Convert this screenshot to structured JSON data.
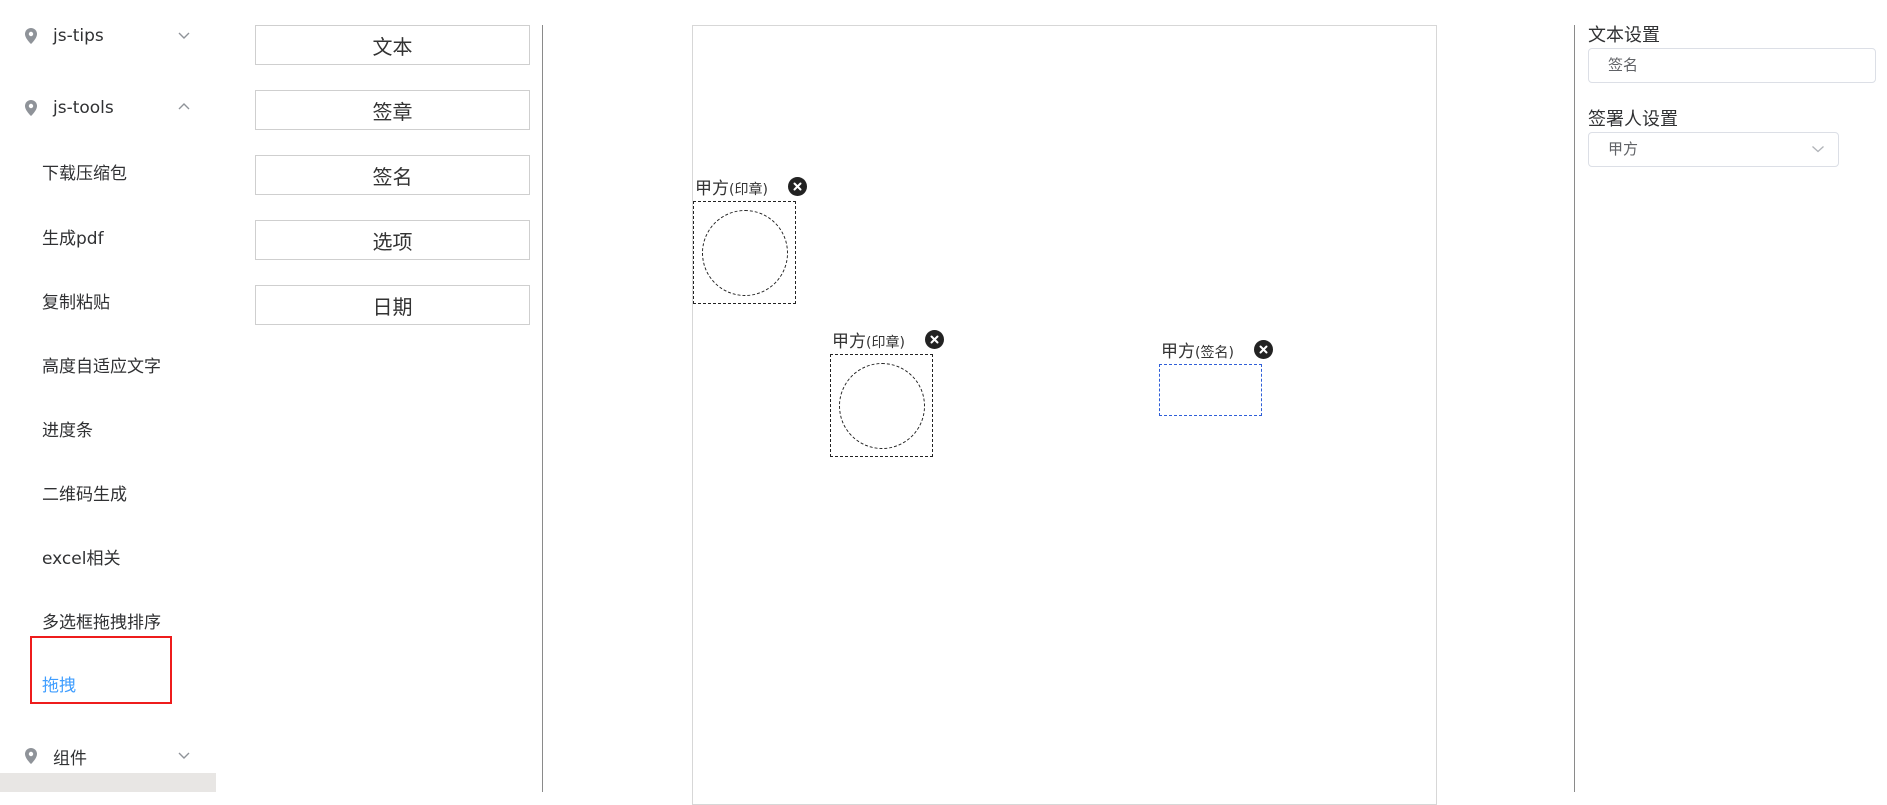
{
  "sidebar": {
    "groups": [
      {
        "label": "js-tools",
        "icon": "location-pin-icon",
        "expanded": true
      },
      {
        "label": "js-tips",
        "icon": "location-pin-icon",
        "expanded": false
      },
      {
        "label": "组件",
        "icon": "location-pin-icon",
        "expanded": false
      }
    ],
    "items": [
      {
        "label": "下载压缩包"
      },
      {
        "label": "生成pdf"
      },
      {
        "label": "复制粘贴"
      },
      {
        "label": "高度自适应文字"
      },
      {
        "label": "进度条"
      },
      {
        "label": "二维码生成"
      },
      {
        "label": "excel相关"
      },
      {
        "label": "多选框拖拽排序"
      },
      {
        "label": "拖拽",
        "active": true
      }
    ]
  },
  "tools": [
    {
      "label": "文本"
    },
    {
      "label": "签章"
    },
    {
      "label": "签名"
    },
    {
      "label": "选项"
    },
    {
      "label": "日期"
    }
  ],
  "canvas": {
    "fields": [
      {
        "party": "甲方",
        "type": "(印章)",
        "kind": "seal",
        "close_icon": "close-circle-icon"
      },
      {
        "party": "甲方",
        "type": "(印章)",
        "kind": "seal",
        "close_icon": "close-circle-icon"
      },
      {
        "party": "甲方",
        "type": "(签名)",
        "kind": "signature",
        "close_icon": "close-circle-icon"
      }
    ]
  },
  "panel": {
    "text_settings_title": "文本设置",
    "text_value": "签名",
    "signer_settings_title": "签署人设置",
    "signer_value": "甲方"
  },
  "colors": {
    "active_menu": "#409eff",
    "active_highlight_border": "#ee1c1c",
    "signature_border": "#2f5fd8"
  }
}
